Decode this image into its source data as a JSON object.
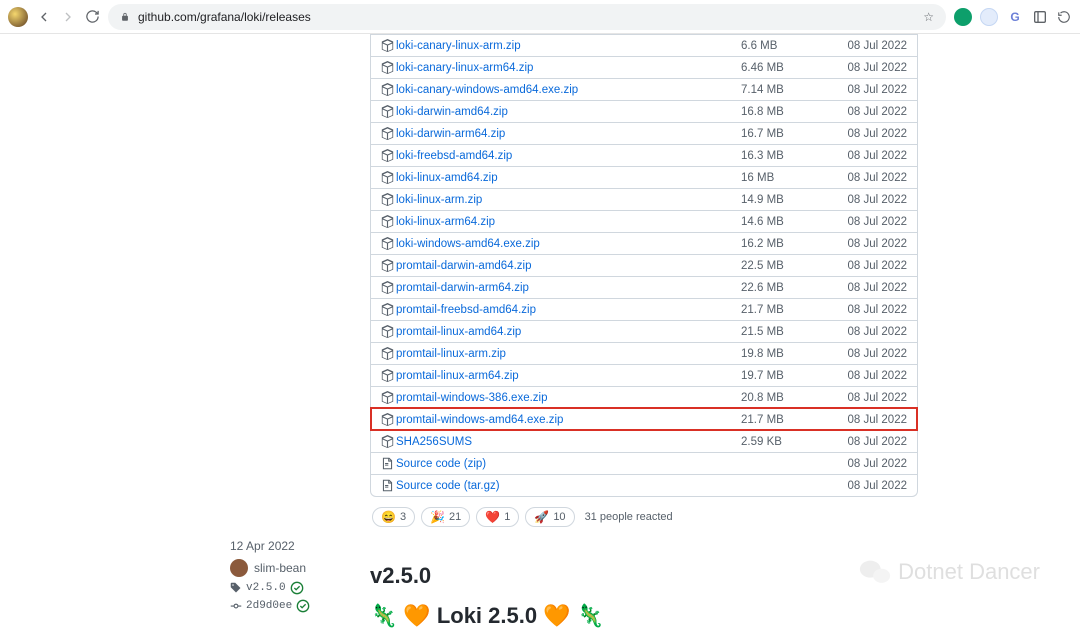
{
  "browser": {
    "url": "github.com/grafana/loki/releases"
  },
  "assets": [
    {
      "name": "loki-canary-linux-arm.zip",
      "size": "6.6 MB",
      "date": "08 Jul 2022",
      "icon": "pkg",
      "highlight": false
    },
    {
      "name": "loki-canary-linux-arm64.zip",
      "size": "6.46 MB",
      "date": "08 Jul 2022",
      "icon": "pkg",
      "highlight": false
    },
    {
      "name": "loki-canary-windows-amd64.exe.zip",
      "size": "7.14 MB",
      "date": "08 Jul 2022",
      "icon": "pkg",
      "highlight": false
    },
    {
      "name": "loki-darwin-amd64.zip",
      "size": "16.8 MB",
      "date": "08 Jul 2022",
      "icon": "pkg",
      "highlight": false
    },
    {
      "name": "loki-darwin-arm64.zip",
      "size": "16.7 MB",
      "date": "08 Jul 2022",
      "icon": "pkg",
      "highlight": false
    },
    {
      "name": "loki-freebsd-amd64.zip",
      "size": "16.3 MB",
      "date": "08 Jul 2022",
      "icon": "pkg",
      "highlight": false
    },
    {
      "name": "loki-linux-amd64.zip",
      "size": "16 MB",
      "date": "08 Jul 2022",
      "icon": "pkg",
      "highlight": false
    },
    {
      "name": "loki-linux-arm.zip",
      "size": "14.9 MB",
      "date": "08 Jul 2022",
      "icon": "pkg",
      "highlight": false
    },
    {
      "name": "loki-linux-arm64.zip",
      "size": "14.6 MB",
      "date": "08 Jul 2022",
      "icon": "pkg",
      "highlight": false
    },
    {
      "name": "loki-windows-amd64.exe.zip",
      "size": "16.2 MB",
      "date": "08 Jul 2022",
      "icon": "pkg",
      "highlight": false
    },
    {
      "name": "promtail-darwin-amd64.zip",
      "size": "22.5 MB",
      "date": "08 Jul 2022",
      "icon": "pkg",
      "highlight": false
    },
    {
      "name": "promtail-darwin-arm64.zip",
      "size": "22.6 MB",
      "date": "08 Jul 2022",
      "icon": "pkg",
      "highlight": false
    },
    {
      "name": "promtail-freebsd-amd64.zip",
      "size": "21.7 MB",
      "date": "08 Jul 2022",
      "icon": "pkg",
      "highlight": false
    },
    {
      "name": "promtail-linux-amd64.zip",
      "size": "21.5 MB",
      "date": "08 Jul 2022",
      "icon": "pkg",
      "highlight": false
    },
    {
      "name": "promtail-linux-arm.zip",
      "size": "19.8 MB",
      "date": "08 Jul 2022",
      "icon": "pkg",
      "highlight": false
    },
    {
      "name": "promtail-linux-arm64.zip",
      "size": "19.7 MB",
      "date": "08 Jul 2022",
      "icon": "pkg",
      "highlight": false
    },
    {
      "name": "promtail-windows-386.exe.zip",
      "size": "20.8 MB",
      "date": "08 Jul 2022",
      "icon": "pkg",
      "highlight": false
    },
    {
      "name": "promtail-windows-amd64.exe.zip",
      "size": "21.7 MB",
      "date": "08 Jul 2022",
      "icon": "pkg",
      "highlight": true
    },
    {
      "name": "SHA256SUMS",
      "size": "2.59 KB",
      "date": "08 Jul 2022",
      "icon": "pkg",
      "highlight": false
    },
    {
      "name": "Source code (zip)",
      "size": "",
      "date": "08 Jul 2022",
      "icon": "file",
      "highlight": false
    },
    {
      "name": "Source code (tar.gz)",
      "size": "",
      "date": "08 Jul 2022",
      "icon": "file",
      "highlight": false
    }
  ],
  "reactions": [
    {
      "emoji": "😄",
      "count": "3"
    },
    {
      "emoji": "🎉",
      "count": "21"
    },
    {
      "emoji": "❤️",
      "count": "1"
    },
    {
      "emoji": "🚀",
      "count": "10"
    }
  ],
  "reactions_text": "31 people reacted",
  "older_release": {
    "date": "12 Apr 2022",
    "author": "slim-bean",
    "tag": "v2.5.0",
    "commit": "2d9d0ee",
    "heading": "v2.5.0",
    "title": "Loki 2.5.0"
  },
  "watermark": "Dotnet Dancer"
}
